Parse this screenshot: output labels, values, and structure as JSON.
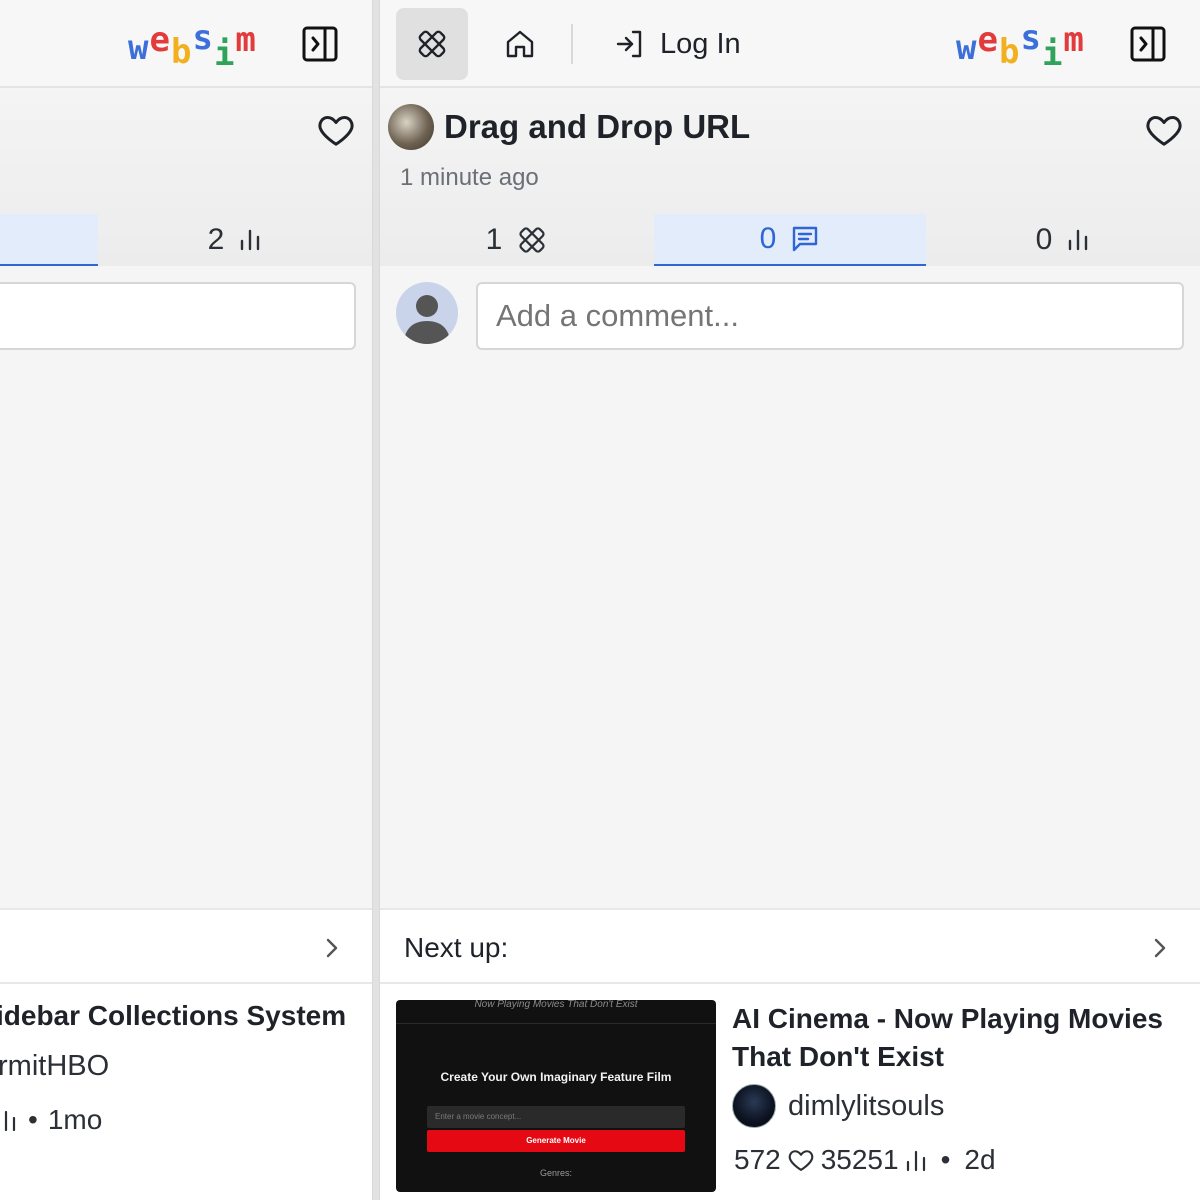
{
  "logo_text": [
    "w",
    "e",
    "b",
    "s",
    "i",
    "m"
  ],
  "left": {
    "tabs": [
      {
        "label": "",
        "active": true
      },
      {
        "label": "2",
        "icon": "bar-chart-icon"
      }
    ],
    "next": {
      "title": "idebar Collections System",
      "author": "rmitHBO",
      "age": "1mo"
    }
  },
  "right": {
    "login_label": "Log In",
    "page": {
      "title": "Drag and Drop URL",
      "time": "1 minute ago"
    },
    "tabs": [
      {
        "label": "1",
        "icon": "remix-icon"
      },
      {
        "label": "0",
        "icon": "comment-icon",
        "active": true
      },
      {
        "label": "0",
        "icon": "bar-chart-icon"
      }
    ],
    "comment_placeholder": "Add a comment...",
    "next_up_label": "Next up:",
    "next": {
      "title": "AI Cinema - Now Playing Movies That Don't Exist",
      "author": "dimlylitsouls",
      "likes": "572",
      "views": "35251",
      "age": "2d",
      "thumbnail": {
        "top_text": "Now Playing Movies That Don't Exist",
        "heading": "Create Your Own Imaginary Feature Film",
        "input_placeholder": "Enter a movie concept...",
        "button_label": "Generate Movie",
        "genres_label": "Genres:"
      }
    }
  },
  "colors": {
    "accent": "#2f66d6",
    "active_tab_bg": "#e3ecfb",
    "generate_button": "#e50914"
  }
}
